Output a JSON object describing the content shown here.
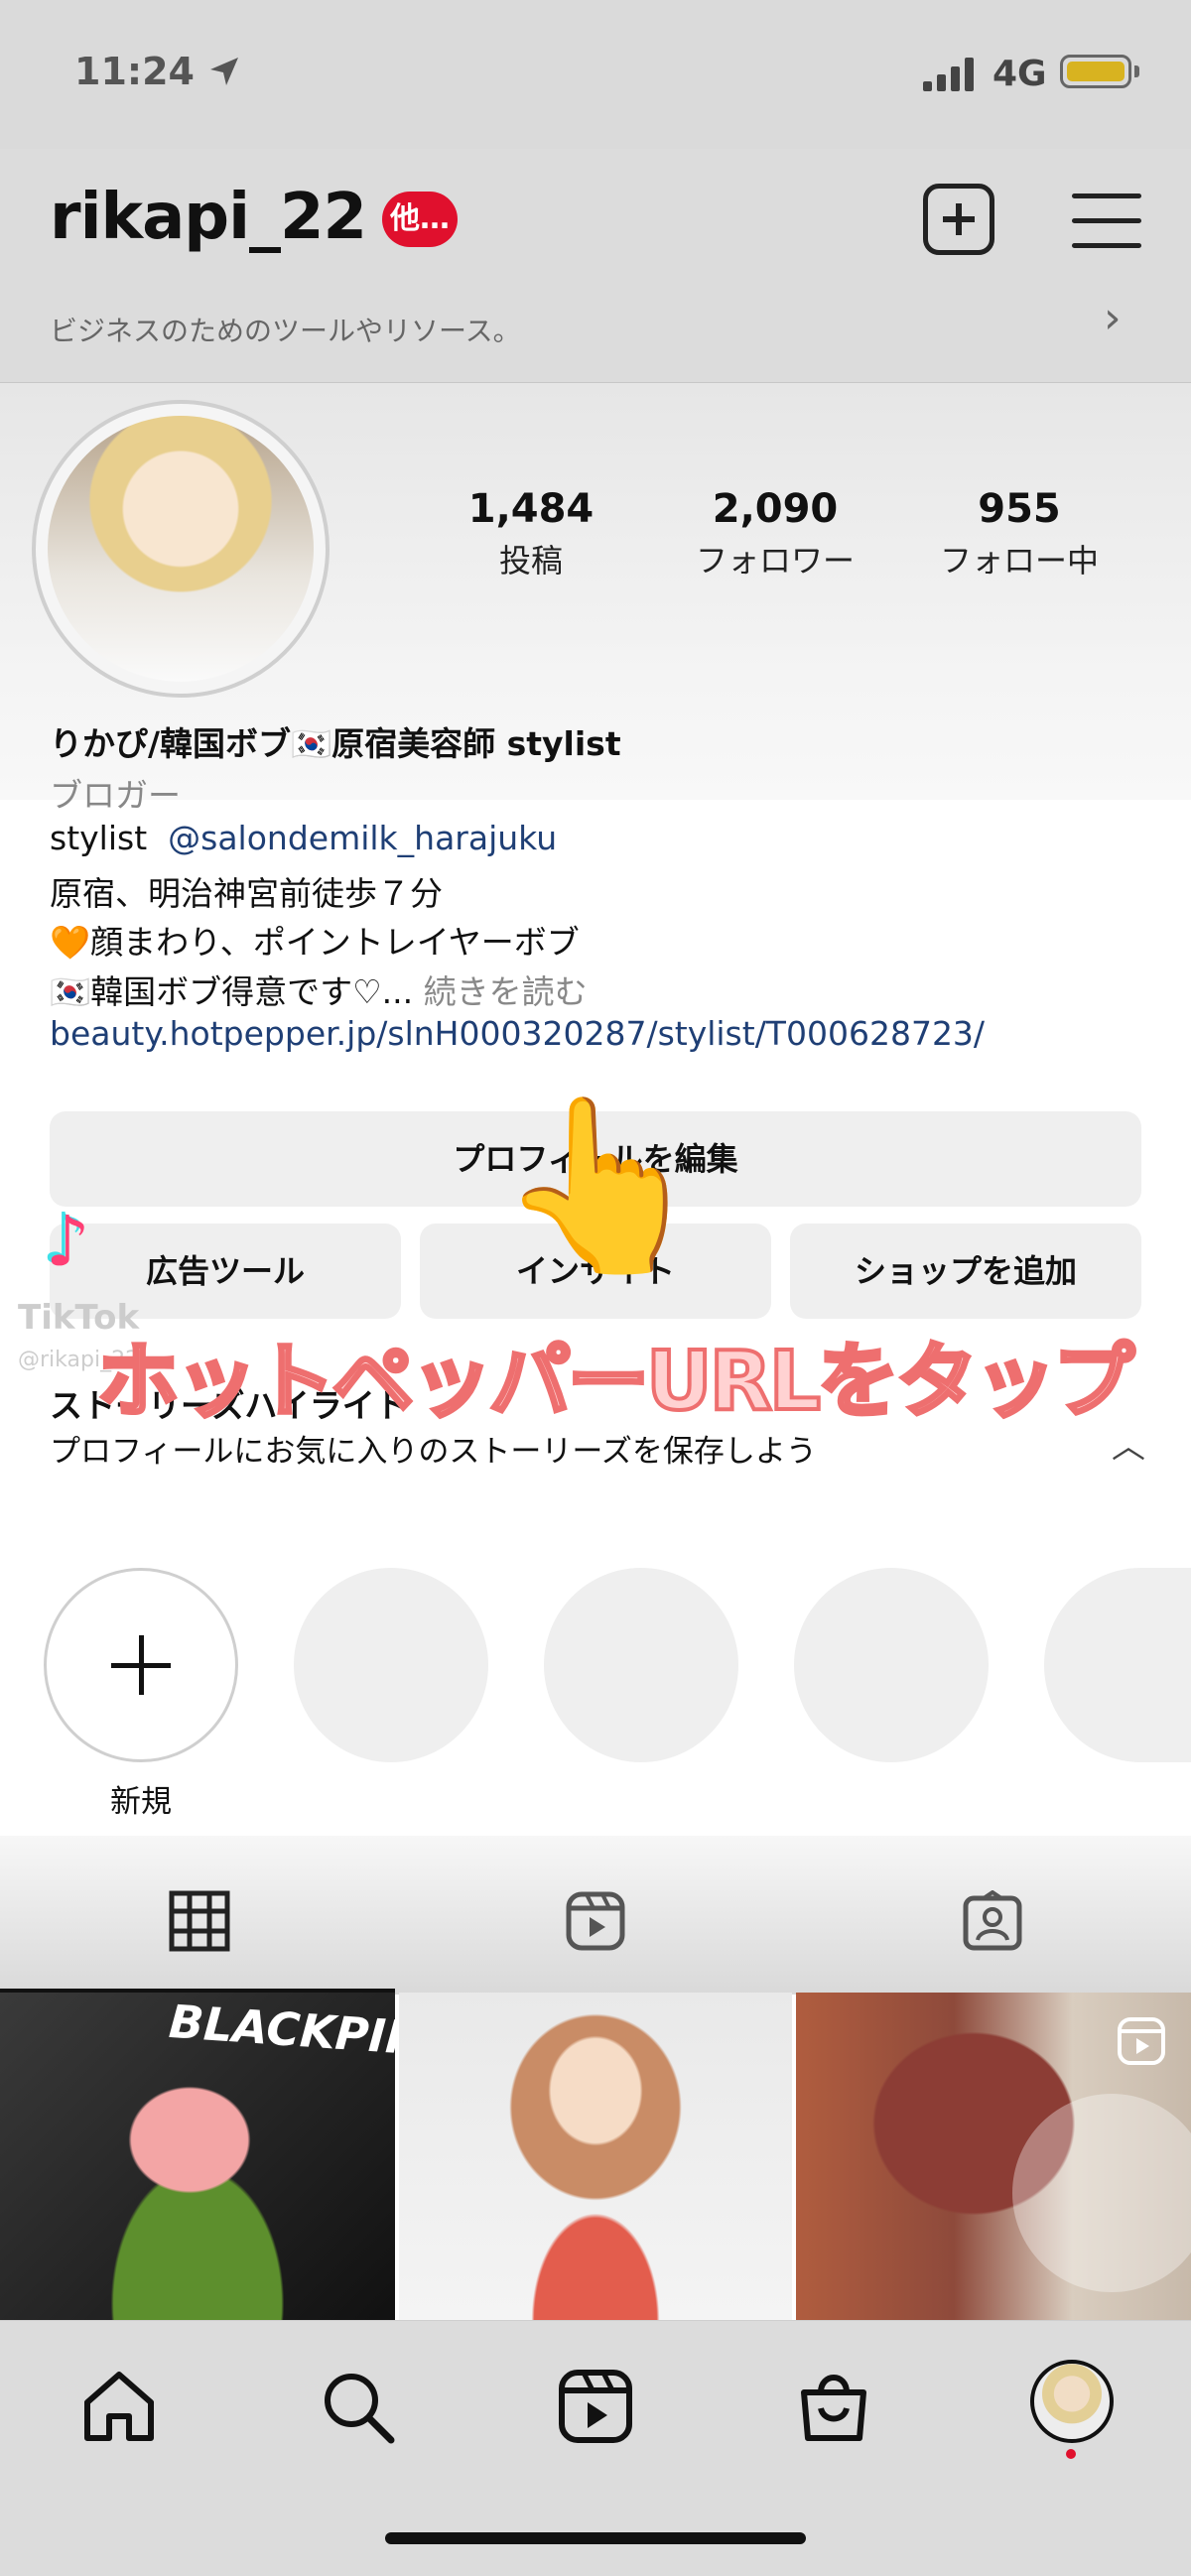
{
  "status_bar": {
    "time": "11:24",
    "network": "4G"
  },
  "header": {
    "username": "rikapi_22",
    "notification_badge": "他…",
    "business_text": "ビジネスのためのツールやリソース。"
  },
  "stats": [
    {
      "value": "1,484",
      "label": "投稿"
    },
    {
      "value": "2,090",
      "label": "フォロワー"
    },
    {
      "value": "955",
      "label": "フォロー中"
    }
  ],
  "bio": {
    "name": "りかぴ/韓国ボブ🇰🇷原宿美容師 stylist",
    "category": "ブロガー",
    "line1_prefix": "stylist",
    "mention": "@salondemilk_harajuku",
    "line2": "原宿、明治神宮前徒歩７分",
    "line3": "🧡顔まわり、ポイントレイヤーボブ",
    "line4": "🇰🇷韓国ボブ得意です♡...",
    "more": "続きを読む",
    "link": "beauty.hotpepper.jp/slnH000320287/stylist/T000628723/"
  },
  "buttons": {
    "edit_profile": "プロフィールを編集",
    "ad_tools": "広告ツール",
    "insights": "インサイト",
    "add_shop": "ショップを追加"
  },
  "overlay": {
    "caption": "ホットペッパーURLをタップ",
    "hand_emoji": "👆",
    "tiktok_logo": "♪",
    "tiktok_word": "TikTok",
    "tiktok_user": "@rikapi_22"
  },
  "highlights": {
    "title": "ストーリーズハイライト",
    "description": "プロフィールにお気に入りのストーリーズを保存しよう",
    "new_label": "新規"
  },
  "tabs": [
    "grid-icon",
    "reels-icon",
    "tagged-icon"
  ],
  "posts": [
    {
      "overlay_text": "BLACKPINK"
    },
    {
      "overlay_text": ""
    },
    {
      "overlay_text": ""
    }
  ],
  "bottom_nav": [
    "home-icon",
    "search-icon",
    "reels-icon",
    "shop-icon",
    "profile-avatar"
  ],
  "colors": {
    "link": "#1f3f75",
    "badge": "#e0102d",
    "caption_fill": "#ffd2d2",
    "caption_stroke": "#ee6f6f",
    "battery": "#d8b320"
  }
}
